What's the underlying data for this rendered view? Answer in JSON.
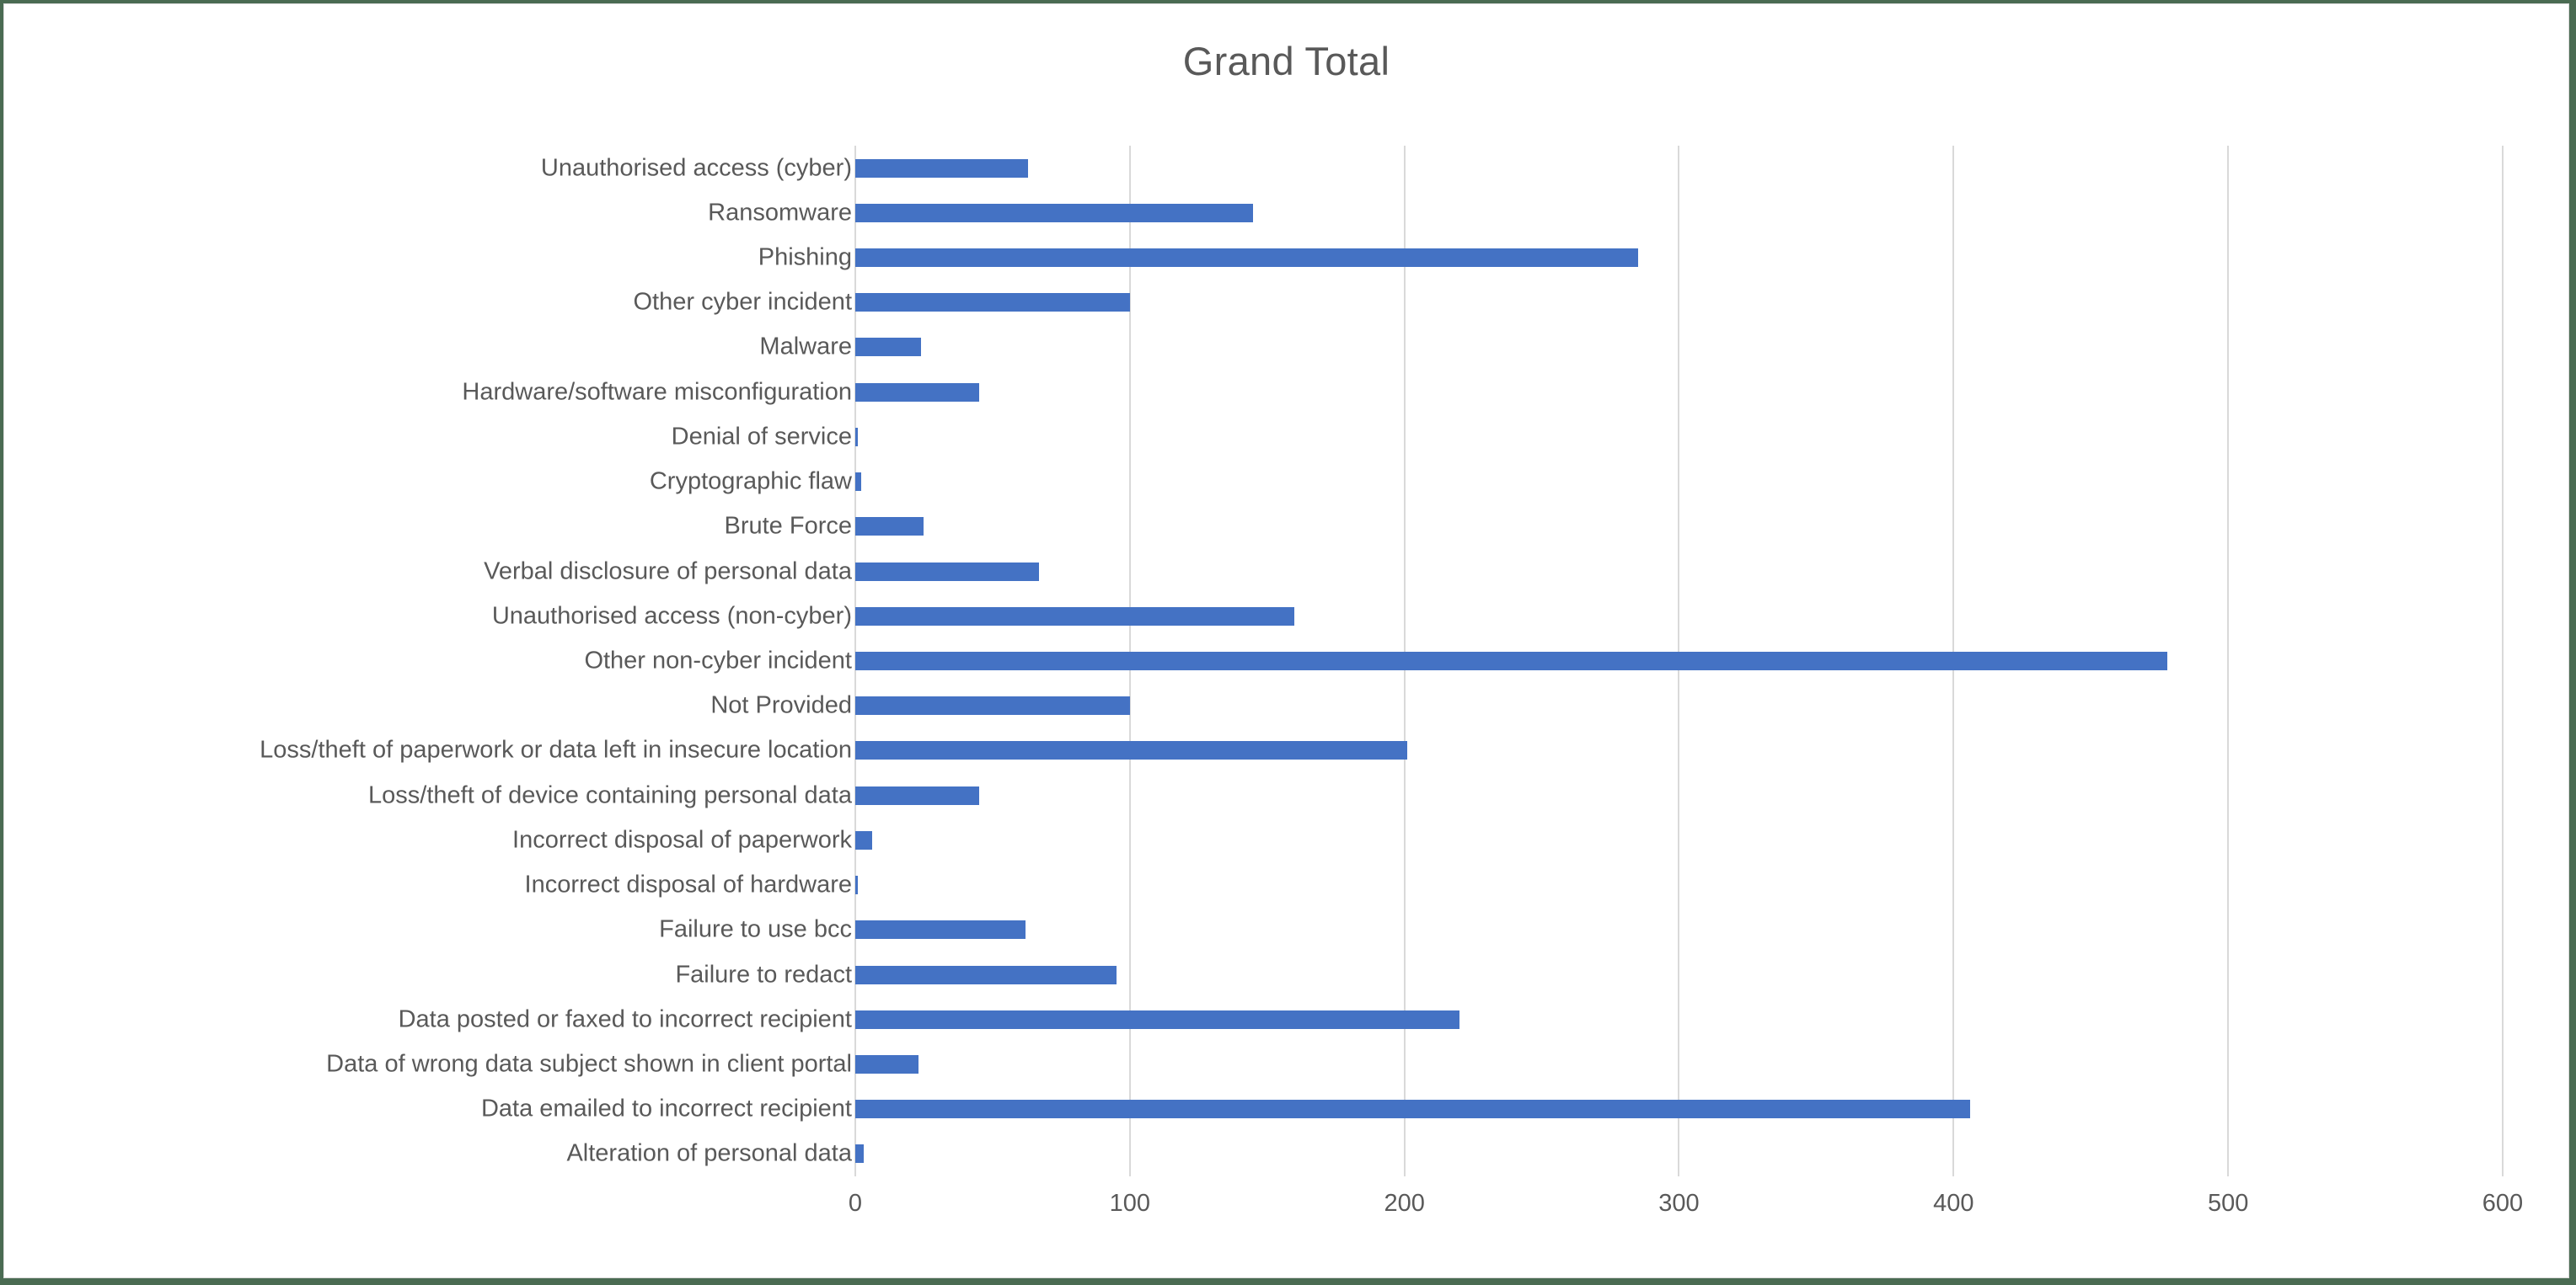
{
  "chart_data": {
    "type": "bar",
    "orientation": "horizontal",
    "title": "Grand Total",
    "xlabel": "",
    "ylabel": "",
    "xlim": [
      0,
      600
    ],
    "xticks": [
      0,
      100,
      200,
      300,
      400,
      500,
      600
    ],
    "xtick_labels": [
      "0",
      "100",
      "200",
      "300",
      "400",
      "500",
      "600"
    ],
    "grid": "vertical",
    "legend": "none",
    "series_color": "#4472C4",
    "categories": [
      "Unauthorised access (cyber)",
      "Ransomware",
      "Phishing",
      "Other cyber incident",
      "Malware",
      "Hardware/software misconfiguration",
      "Denial of service",
      "Cryptographic flaw",
      "Brute Force",
      "Verbal disclosure of personal data",
      "Unauthorised access (non-cyber)",
      "Other non-cyber incident",
      "Not Provided",
      "Loss/theft of paperwork or data left in insecure location",
      "Loss/theft of device containing personal data",
      "Incorrect disposal of paperwork",
      "Incorrect disposal of hardware",
      "Failure to use bcc",
      "Failure to redact",
      "Data posted or faxed to incorrect recipient",
      "Data of wrong data subject shown in client portal",
      "Data emailed to incorrect recipient",
      "Alteration of personal data"
    ],
    "values": [
      63,
      145,
      285,
      100,
      24,
      45,
      1,
      2,
      25,
      67,
      160,
      478,
      100,
      201,
      45,
      6,
      1,
      62,
      95,
      220,
      23,
      406,
      3
    ]
  }
}
